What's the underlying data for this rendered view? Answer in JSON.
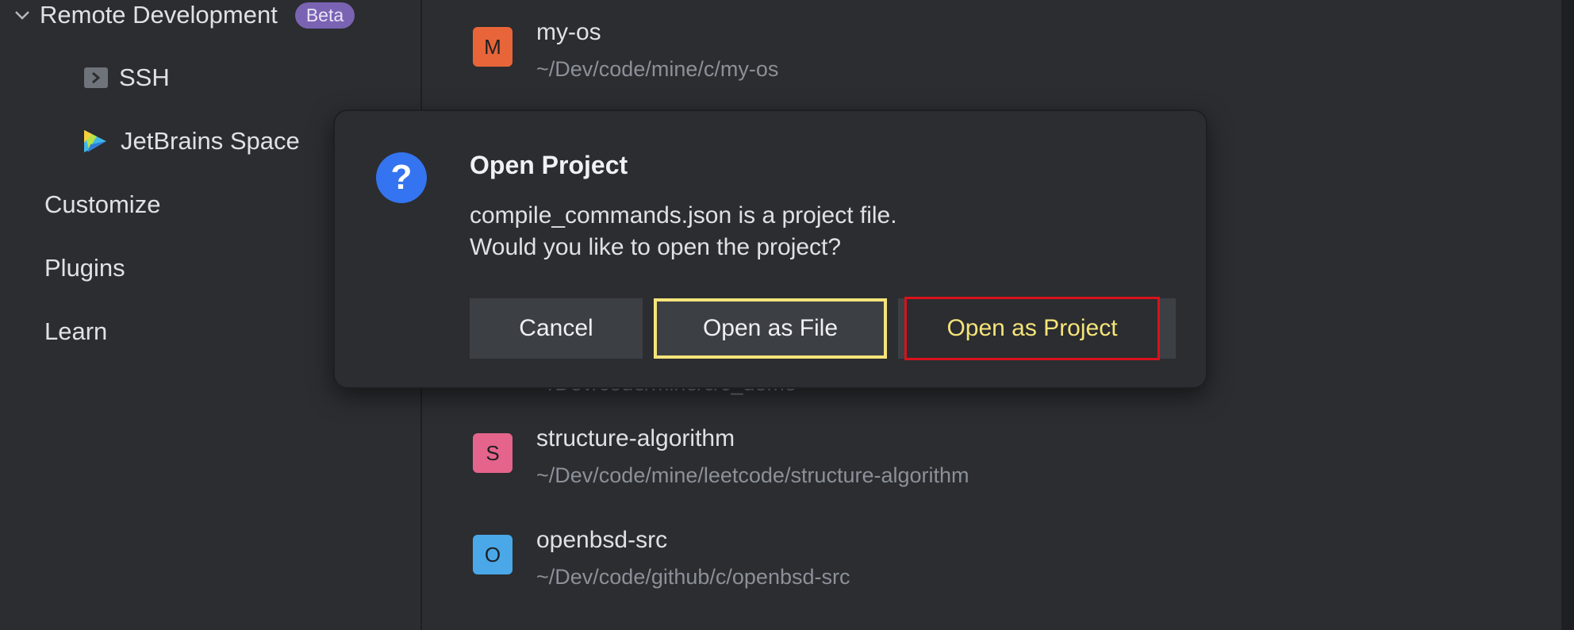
{
  "sidebar": {
    "remote_dev": {
      "label": "Remote Development",
      "badge": "Beta"
    },
    "ssh": {
      "label": "SSH",
      "icon": "terminal-icon"
    },
    "space": {
      "label": "JetBrains Space",
      "icon": "jetbrains-space-icon"
    },
    "customize": "Customize",
    "plugins": "Plugins",
    "learn": "Learn"
  },
  "projects": [
    {
      "letter": "M",
      "name": "my-os",
      "path": "~/Dev/code/mine/c/my-os",
      "color": "#e8653a"
    },
    {
      "letter": "S",
      "name": "structure-algorithm",
      "path": "~/Dev/code/mine/leetcode/structure-algorithm",
      "color": "#e5648c"
    },
    {
      "letter": "O",
      "name": "openbsd-src",
      "path": "~/Dev/code/github/c/openbsd-src",
      "color": "#4aa8e8"
    }
  ],
  "hidden_path": "~/Dev/code/mine/c/c_demo",
  "dialog": {
    "title": "Open Project",
    "message_line1": "compile_commands.json is a project file.",
    "message_line2": "Would you like to open the project?",
    "cancel": "Cancel",
    "open_as_file": "Open as File",
    "open_as_project": "Open as Project",
    "icon": "question-icon"
  }
}
